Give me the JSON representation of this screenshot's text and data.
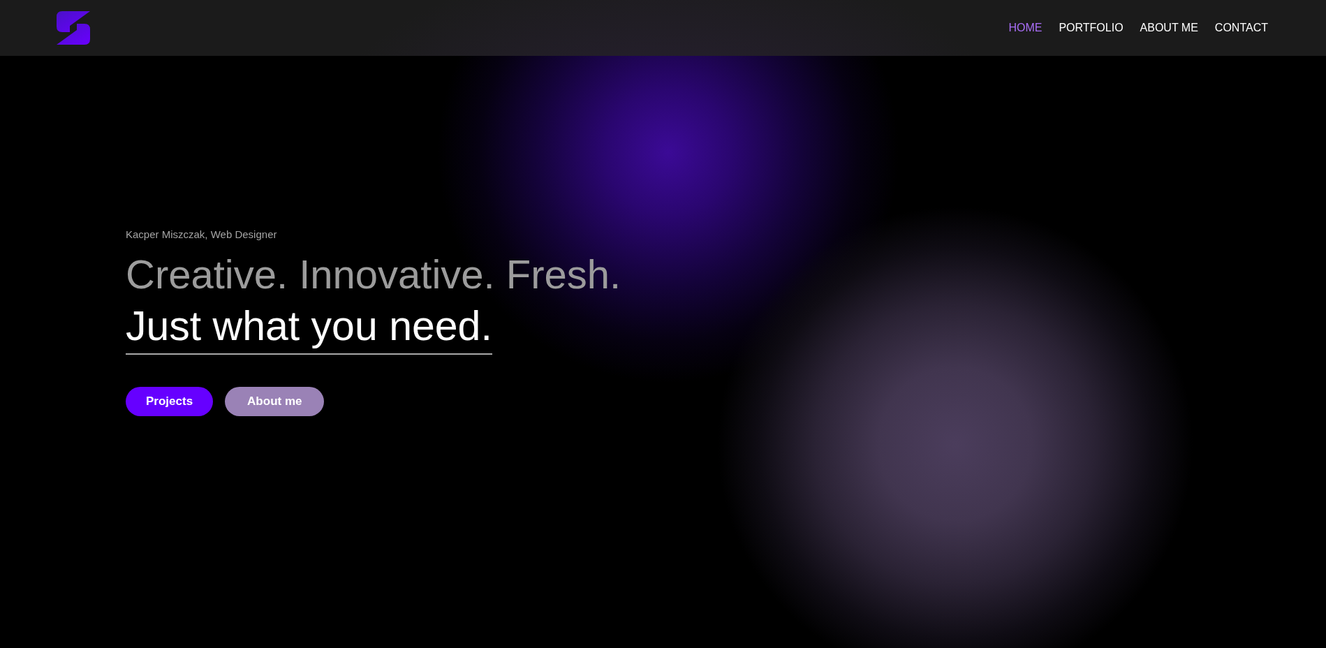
{
  "header": {
    "nav": [
      {
        "label": "HOME",
        "selected": true
      },
      {
        "label": "PORTFOLIO",
        "selected": false
      },
      {
        "label": "ABOUT ME",
        "selected": false
      },
      {
        "label": "CONTACT",
        "selected": false
      }
    ]
  },
  "hero": {
    "subtitle": "Kacper Miszczak, Web Designer",
    "headline": "Creative. Innovative. Fresh.",
    "tagline": "Just what you need.",
    "buttons": [
      {
        "label": "Projects",
        "kind": "primary"
      },
      {
        "label": "About me",
        "kind": "secondary"
      }
    ]
  }
}
